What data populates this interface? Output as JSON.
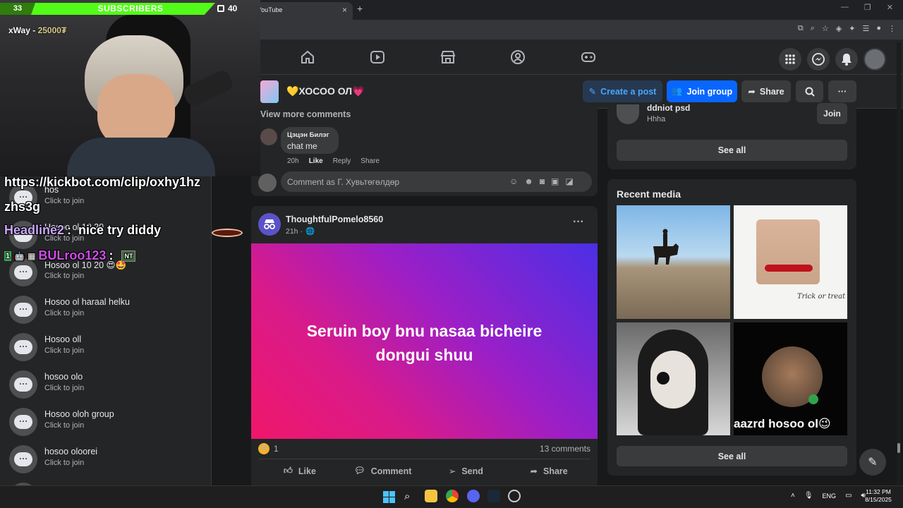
{
  "browser": {
    "tab_title": "YouTube",
    "tab_close": "×",
    "new_tab": "+",
    "window_controls": [
      "—",
      "❐",
      "✕"
    ]
  },
  "stream_overlay": {
    "sub_count": "33",
    "sub_label": "SUBSCRIBERS",
    "sub_goal": "40",
    "streamer_name": "xWay -",
    "streamer_amount": "25000₮",
    "chat_link": "https://kickbot.com/clip/oxhy1hz",
    "chat_link_cont": "zhs3g",
    "chat_user1": "Headline2",
    "chat_msg1": "nice try diddy",
    "chat_user2": "BULroo123",
    "badge_nt": "NT"
  },
  "group": {
    "name": "💛ХОСОО ОЛ💗",
    "create_post": "Create a post",
    "join_group": "Join group",
    "share": "Share",
    "more": "···"
  },
  "comments": {
    "view_more": "View more comments",
    "author": "Цэцэн Билэг",
    "text": "chat me",
    "time": "20h",
    "like": "Like",
    "reply": "Reply",
    "share": "Share",
    "input_placeholder": "Comment as Г. Хувьтөгөлдөр"
  },
  "post": {
    "author": "ThoughtfulPomelo8560",
    "time": "21h ·",
    "text_line1": "Seruin boy bnu nasaa bicheire",
    "text_line2": "dongui shuu",
    "reaction_count": "1",
    "comments_count": "13 comments",
    "action_like": "Like",
    "action_comment": "Comment",
    "action_send": "Send",
    "action_share": "Share",
    "colors": {
      "grad_start": "#f0176a",
      "grad_end": "#5b2ee0"
    }
  },
  "side": {
    "suggested_name": "ddniot psd",
    "suggested_sub": "Hhha",
    "join": "Join",
    "see_all_1": "See all",
    "recent_media_title": "Recent media",
    "media_caption": "aazrd hosoo ol😉",
    "see_all_2": "See all"
  },
  "chat_list": [
    {
      "title": "hos",
      "sub": "Click to join"
    },
    {
      "title": "Hosoo ol 10 20",
      "sub": "Click to join"
    },
    {
      "title": "Hosoo ol 10 20 😍🤩",
      "sub": "Click to join"
    },
    {
      "title": "Hosoo ol haraal helku",
      "sub": "Click to join"
    },
    {
      "title": "Hosoo oll",
      "sub": "Click to join"
    },
    {
      "title": "hosoo olo",
      "sub": "Click to join"
    },
    {
      "title": "Hosoo oloh group",
      "sub": "Click to join"
    },
    {
      "title": "hosoo oloorei",
      "sub": "Click to join"
    }
  ],
  "taskbar": {
    "lang": "ENG",
    "time": "11:32 PM",
    "date": "8/15/2025"
  }
}
